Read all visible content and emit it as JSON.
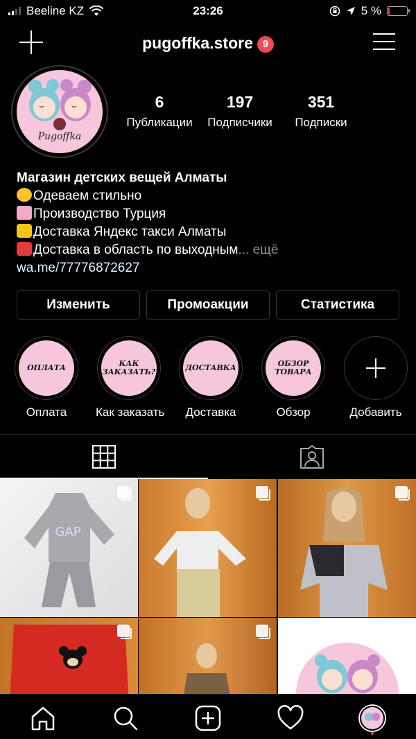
{
  "status_bar": {
    "carrier": "Beeline KZ",
    "time": "23:26",
    "battery": "5 %",
    "battery_level": 0.05
  },
  "header": {
    "username": "pugoffka.store",
    "notification_count": "9",
    "new_post_icon": "plus-icon",
    "menu_icon": "hamburger-menu-icon"
  },
  "profile": {
    "avatar_text": "Pugoffka",
    "stats": [
      {
        "value": "6",
        "label": "Публикации"
      },
      {
        "value": "197",
        "label": "Подписчики"
      },
      {
        "value": "351",
        "label": "Подписки"
      }
    ]
  },
  "bio": {
    "name": "Магазин детских вещей Алматы",
    "lines": [
      "Одеваем стильно",
      "Производство Турция",
      "Доставка Яндекс такси Алматы",
      "Доставка в область по выходным"
    ],
    "more": "... ещё",
    "link": "wa.me/77776872627"
  },
  "actions": {
    "edit": "Изменить",
    "promo": "Промоакции",
    "stats": "Статистика"
  },
  "highlights": [
    {
      "cover_text": "ОПЛАТА",
      "label": "Оплата"
    },
    {
      "cover_text": "КАК ЗАКАЗАТЬ?",
      "label": "Как заказать"
    },
    {
      "cover_text": "ДОСТАВКА",
      "label": "Доставка"
    },
    {
      "cover_text": "ОБЗОР ТОВАРА",
      "label": "Обзор"
    },
    {
      "cover_text": "",
      "label": "Добавить"
    }
  ],
  "tabs": {
    "grid_icon": "grid-icon",
    "tagged_icon": "tagged-person-icon",
    "active": "grid"
  },
  "bottom_nav": [
    "home-icon",
    "search-icon",
    "new-post-icon",
    "heart-icon",
    "profile-avatar"
  ],
  "colors": {
    "background": "#000000",
    "badge": "#ed4956",
    "highlight_bg": "#f5c6dc",
    "border": "#363636"
  }
}
